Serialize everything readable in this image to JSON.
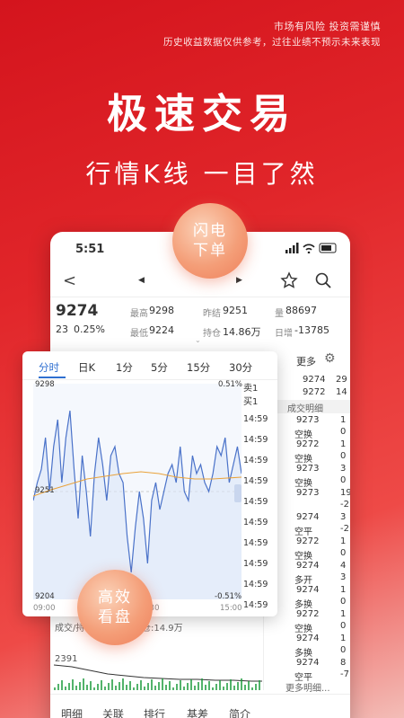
{
  "disclaimer": {
    "line1": "市场有风险 投资需谨慎",
    "line2": "历史收益数据仅供参考，过往业绩不预示未来表现"
  },
  "hero": {
    "title": "极速交易",
    "subtitle": "行情K线 一目了然"
  },
  "bubbles": {
    "top_line1": "闪电",
    "top_line2": "下单",
    "bottom_line1": "高效",
    "bottom_line2": "看盘"
  },
  "status_bar": {
    "time": "5:51"
  },
  "nav": {
    "back": "<"
  },
  "quote": {
    "price": "9274",
    "change": "23",
    "change_pct": "0.25%",
    "high_label": "最高",
    "high": "9298",
    "low_label": "最低",
    "low": "9224",
    "prev_label": "昨结",
    "prev": "9251",
    "oi_label": "持仓",
    "oi": "14.86万",
    "vol_label": "量",
    "vol": "88697",
    "daily_label": "日增",
    "daily": "-13785"
  },
  "more_label": "更多",
  "chart_tabs": [
    "分时",
    "日K",
    "1分",
    "5分",
    "15分",
    "30分"
  ],
  "chart": {
    "top_left": "9298",
    "top_right": "0.51%",
    "mid_left": "9251",
    "bottom_left": "9204",
    "bottom_right": "-0.51%",
    "x_start": "09:00",
    "x_mid": "13:30",
    "x_end": "15:00",
    "vol_label": "成交/持",
    "oi_text": "仓:14.9万",
    "vol_value": "2391"
  },
  "order_book": {
    "sell1": "卖1",
    "buy1": "买1",
    "sell_price": "9274",
    "sell_vol": "29",
    "buy_price": "9272",
    "buy_vol": "14"
  },
  "trades_header": "成交明细",
  "trade_times": [
    "14:59",
    "14:59",
    "14:59",
    "14:59",
    "14:59",
    "14:59",
    "14:59",
    "14:59",
    "14:59",
    "14:59"
  ],
  "trades": [
    {
      "price": "9273",
      "vol": "1",
      "type": "空换",
      "n": "0"
    },
    {
      "price": "9272",
      "vol": "1",
      "type": "空换",
      "n": "0"
    },
    {
      "price": "9273",
      "vol": "3",
      "type": "空换",
      "n": "0"
    },
    {
      "price": "9273",
      "vol": "19",
      "type": "",
      "n": "-2"
    },
    {
      "price": "9274",
      "vol": "3",
      "type": "空平",
      "n": "-2"
    },
    {
      "price": "9272",
      "vol": "1",
      "type": "空换",
      "n": "0"
    },
    {
      "price": "9274",
      "vol": "4",
      "type": "多开",
      "n": "3"
    },
    {
      "price": "9274",
      "vol": "1",
      "type": "多换",
      "n": "0"
    },
    {
      "price": "9272",
      "vol": "1",
      "type": "空换",
      "n": "0"
    },
    {
      "price": "9274",
      "vol": "1",
      "type": "多换",
      "n": "0"
    },
    {
      "price": "9274",
      "vol": "8",
      "type": "空平",
      "n": "-7"
    }
  ],
  "more_trades": "更多明细...",
  "bottom_tabs": [
    "明细",
    "关联",
    "排行",
    "基差",
    "简介"
  ],
  "colors": {
    "up": "#e32b2b",
    "down": "#1a9a3a",
    "accent": "#2f6fd0"
  }
}
